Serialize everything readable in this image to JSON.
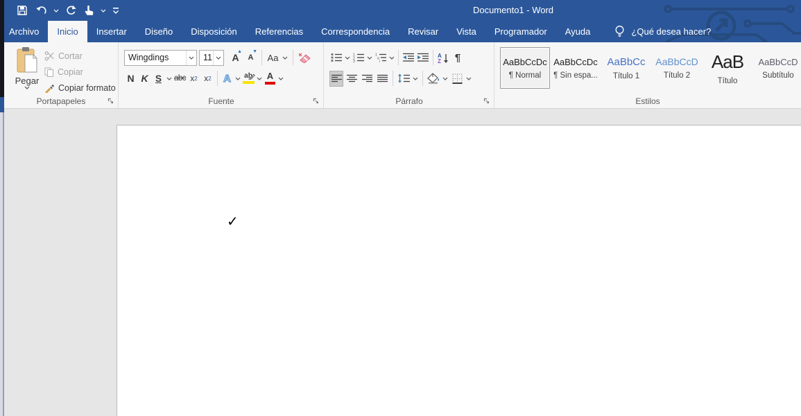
{
  "window": {
    "title": "Documento1 - Word"
  },
  "tabs": {
    "items": [
      {
        "label": "Archivo"
      },
      {
        "label": "Inicio"
      },
      {
        "label": "Insertar"
      },
      {
        "label": "Diseño"
      },
      {
        "label": "Disposición"
      },
      {
        "label": "Referencias"
      },
      {
        "label": "Correspondencia"
      },
      {
        "label": "Revisar"
      },
      {
        "label": "Vista"
      },
      {
        "label": "Programador"
      },
      {
        "label": "Ayuda"
      }
    ],
    "active": "Inicio",
    "tell_me": "¿Qué desea hacer?"
  },
  "ribbon": {
    "clipboard": {
      "label": "Portapapeles",
      "paste_label": "Pegar",
      "cut_label": "Cortar",
      "copy_label": "Copiar",
      "format_painter_label": "Copiar formato"
    },
    "font": {
      "label": "Fuente",
      "font_name_value": "Wingdings",
      "font_size_value": "11",
      "grow_glyph": "A",
      "shrink_glyph": "A",
      "case_glyph": "Aa",
      "bold_glyph": "N",
      "italic_glyph": "K",
      "underline_glyph": "S",
      "strikethrough_glyph": "abc",
      "sub_base": "x",
      "sub_num": "2",
      "sup_base": "x",
      "sup_num": "2",
      "effects_glyph": "A",
      "highlight_glyph": "ab",
      "color_glyph": "A"
    },
    "paragraph": {
      "label": "Párrafo",
      "pilcrow": "¶",
      "sort_a": "A",
      "sort_z": "Z"
    },
    "styles": {
      "label": "Estilos",
      "items": [
        {
          "sample": "AaBbCcDc",
          "name": "¶ Normal"
        },
        {
          "sample": "AaBbCcDc",
          "name": "¶ Sin espa..."
        },
        {
          "sample": "AaBbCc",
          "name": "Título 1"
        },
        {
          "sample": "AaBbCcD",
          "name": "Título 2"
        },
        {
          "sample": "AaB",
          "name": "Título"
        },
        {
          "sample": "AaBbCcD",
          "name": "Subtítulo"
        }
      ]
    }
  },
  "document": {
    "content": "✓"
  },
  "colors": {
    "titlebar_blue": "#2b579a",
    "circuit_line": "#264b80",
    "highlight_yellow": "#f9e400",
    "font_color_red": "#e00000",
    "heading_blue": "#4472c4"
  }
}
